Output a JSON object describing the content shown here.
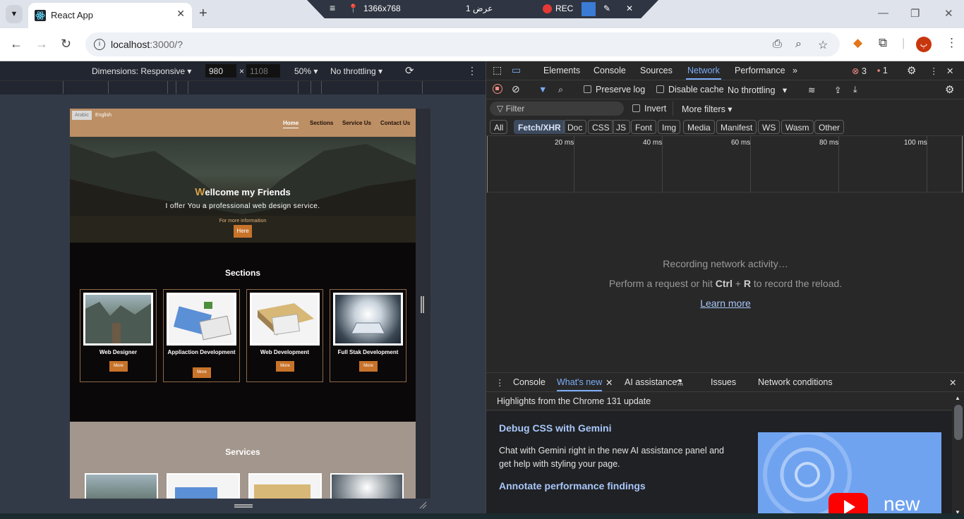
{
  "browser": {
    "tab_title": "React App",
    "url_host": "localhost",
    "url_rest": ":3000/?"
  },
  "recorder": {
    "resolution": "1366x768",
    "display": "عرض 1",
    "rec_label": "REC"
  },
  "device_toolbar": {
    "dimensions_label": "Dimensions: Responsive",
    "width": "980",
    "height_placeholder": "1108",
    "times": "×",
    "zoom": "50%",
    "throttle": "No throttling"
  },
  "site": {
    "lang_arabic": "Arabic",
    "lang_english": "English",
    "nav": [
      "Home",
      "Sections",
      "Service Us",
      "Contact Us"
    ],
    "hero_title_first": "W",
    "hero_title_rest": "ellcome my Friends",
    "hero_sub": "I offer You a professional web design service.",
    "hero_info": "For more informaition",
    "hero_button": "Here",
    "sections_title": "Sections",
    "cards": [
      "Web Designer",
      "Appliaction Development",
      "Web Development",
      "Full Stak Development"
    ],
    "more": "More",
    "services_title": "Services"
  },
  "devtools": {
    "tabs": [
      "Elements",
      "Console",
      "Sources",
      "Network",
      "Performance"
    ],
    "active_tab": "Network",
    "errors": "3",
    "warnings": "1",
    "preserve_log": "Preserve log",
    "disable_cache": "Disable cache",
    "throttle": "No throttling",
    "filter_placeholder": "Filter",
    "invert": "Invert",
    "more_filters": "More filters",
    "types": [
      "All",
      "Fetch/XHR",
      "Doc",
      "CSS",
      "JS",
      "Font",
      "Img",
      "Media",
      "Manifest",
      "WS",
      "Wasm",
      "Other"
    ],
    "ticks": [
      "20 ms",
      "40 ms",
      "60 ms",
      "80 ms",
      "100 ms"
    ],
    "empty_title": "Recording network activity…",
    "empty_pre": "Perform a request or hit ",
    "empty_key1": "Ctrl",
    "empty_plus": " + ",
    "empty_key2": "R",
    "empty_post": " to record the reload.",
    "learn_more": "Learn more",
    "drawer_tabs": [
      "Console",
      "What's new",
      "AI assistance",
      "Issues",
      "Network conditions"
    ],
    "highlights": "Highlights from the Chrome 131 update",
    "wn_h1": "Debug CSS with Gemini",
    "wn_p1": "Chat with Gemini right in the new AI assistance panel and get help with styling your page.",
    "wn_h2": "Annotate performance findings",
    "thumb_text": "new"
  },
  "colors": {
    "accent_blue": "#7cacf8",
    "site_header": "#bc8f65",
    "site_button": "#c8732a",
    "rec_red": "#e53935"
  }
}
